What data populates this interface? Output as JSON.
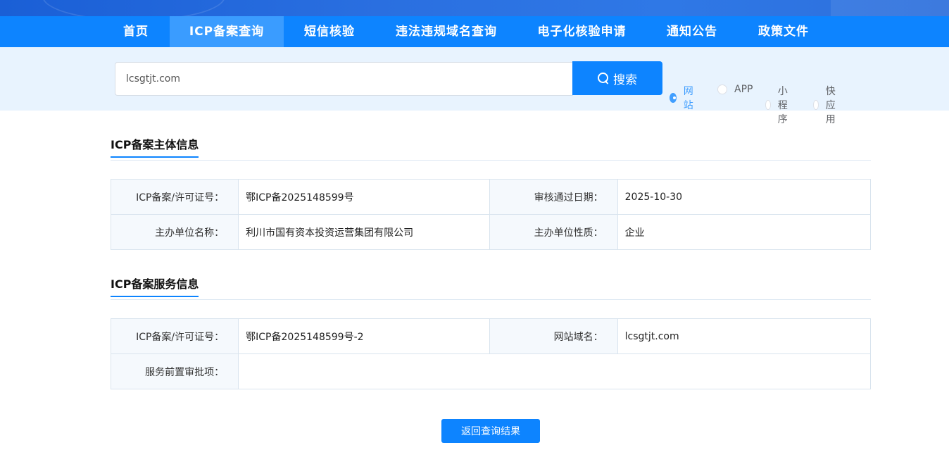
{
  "nav": {
    "items": [
      {
        "label": "首页"
      },
      {
        "label": "ICP备案查询"
      },
      {
        "label": "短信核验"
      },
      {
        "label": "违法违规域名查询"
      },
      {
        "label": "电子化核验申请"
      },
      {
        "label": "通知公告"
      },
      {
        "label": "政策文件"
      }
    ],
    "active": "ICP备案查询"
  },
  "search": {
    "value": "lcsgtjt.com",
    "button_label": "搜索",
    "types": [
      {
        "label": "网站",
        "checked": true
      },
      {
        "label": "APP",
        "checked": false
      },
      {
        "label": "小程序",
        "checked": false
      },
      {
        "label": "快应用",
        "checked": false
      }
    ]
  },
  "subject": {
    "title": "ICP备案主体信息",
    "license_label": "ICP备案/许可证号：",
    "license_value": "鄂ICP备2025148599号",
    "date_label": "审核通过日期：",
    "date_value": "2025-10-30",
    "org_label": "主办单位名称：",
    "org_value": "利川市国有资本投资运营集团有限公司",
    "nature_label": "主办单位性质：",
    "nature_value": "企业"
  },
  "service": {
    "title": "ICP备案服务信息",
    "license_label": "ICP备案/许可证号：",
    "license_value": "鄂ICP备2025148599号-2",
    "domain_label": "网站域名：",
    "domain_value": "lcsgtjt.com",
    "approval_label": "服务前置审批项：",
    "approval_value": ""
  },
  "back_button": "返回查询结果",
  "colors": {
    "primary": "#0d84ff",
    "nav_active": "#3a9cff",
    "search_bg": "#e8f3fe",
    "radio_checked": "#409eff"
  }
}
